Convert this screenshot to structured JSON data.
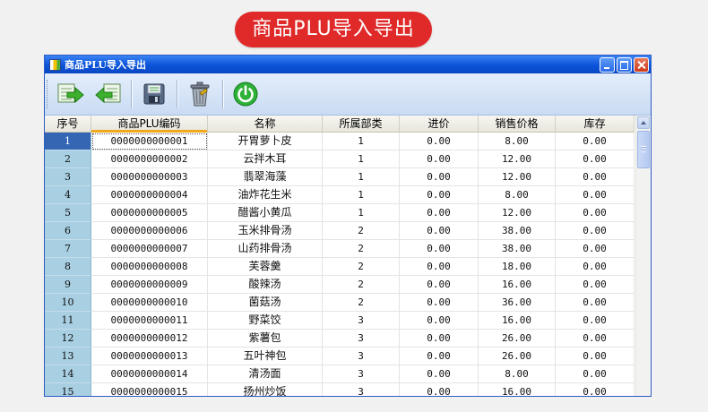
{
  "banner": {
    "title": "商品PLU导入导出"
  },
  "window": {
    "title": "商品PLU导入导出",
    "controls": {
      "minimize": "minimize",
      "maximize": "maximize",
      "close": "close"
    }
  },
  "toolbar": {
    "buttons": [
      {
        "icon": "import-icon"
      },
      {
        "icon": "export-icon"
      },
      {
        "icon": "save-icon"
      },
      {
        "icon": "delete-icon"
      },
      {
        "icon": "power-icon"
      }
    ]
  },
  "table": {
    "columns": [
      "序号",
      "商品PLU编码",
      "名称",
      "所属部类",
      "进价",
      "销售价格",
      "库存"
    ],
    "sorted_column": 1,
    "selected_row": 0,
    "rows": [
      [
        "1",
        "0000000000001",
        "开胃萝卜皮",
        "1",
        "0.00",
        "8.00",
        "0.00"
      ],
      [
        "2",
        "0000000000002",
        "云拌木耳",
        "1",
        "0.00",
        "12.00",
        "0.00"
      ],
      [
        "3",
        "0000000000003",
        "翡翠海藻",
        "1",
        "0.00",
        "12.00",
        "0.00"
      ],
      [
        "4",
        "0000000000004",
        "油炸花生米",
        "1",
        "0.00",
        "8.00",
        "0.00"
      ],
      [
        "5",
        "0000000000005",
        "醋酱小黄瓜",
        "1",
        "0.00",
        "12.00",
        "0.00"
      ],
      [
        "6",
        "0000000000006",
        "玉米排骨汤",
        "2",
        "0.00",
        "38.00",
        "0.00"
      ],
      [
        "7",
        "0000000000007",
        "山药排骨汤",
        "2",
        "0.00",
        "38.00",
        "0.00"
      ],
      [
        "8",
        "0000000000008",
        "芙蓉羹",
        "2",
        "0.00",
        "18.00",
        "0.00"
      ],
      [
        "9",
        "0000000000009",
        "酸辣汤",
        "2",
        "0.00",
        "16.00",
        "0.00"
      ],
      [
        "10",
        "0000000000010",
        "菌菇汤",
        "2",
        "0.00",
        "36.00",
        "0.00"
      ],
      [
        "11",
        "0000000000011",
        "野菜饺",
        "3",
        "0.00",
        "16.00",
        "0.00"
      ],
      [
        "12",
        "0000000000012",
        "紫薯包",
        "3",
        "0.00",
        "26.00",
        "0.00"
      ],
      [
        "13",
        "0000000000013",
        "五叶神包",
        "3",
        "0.00",
        "26.00",
        "0.00"
      ],
      [
        "14",
        "0000000000014",
        "清汤面",
        "3",
        "0.00",
        "8.00",
        "0.00"
      ],
      [
        "15",
        "0000000000015",
        "扬州炒饭",
        "3",
        "0.00",
        "16.00",
        "0.00"
      ]
    ]
  }
}
